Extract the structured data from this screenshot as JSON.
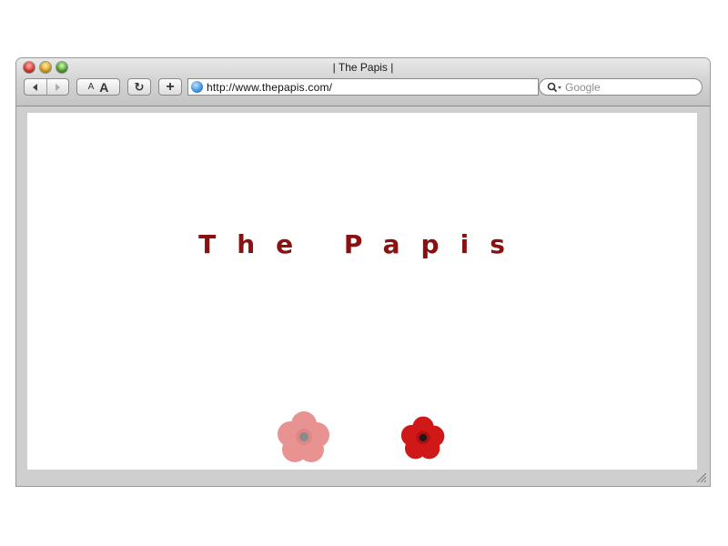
{
  "window": {
    "title": "| The Papis |"
  },
  "toolbar": {
    "back_icon": "back-arrow-icon",
    "forward_icon": "forward-arrow-icon",
    "text_smaller_label": "A",
    "text_bigger_label": "A",
    "reload_label": "↻",
    "add_bookmark_label": "+",
    "url": "http://www.thepapis.com/",
    "search_placeholder": "Google"
  },
  "page": {
    "title": "The Papis",
    "title_color": "#8b1010"
  },
  "colors": {
    "accent": "#8b1010",
    "flower_red": "#d01818"
  }
}
